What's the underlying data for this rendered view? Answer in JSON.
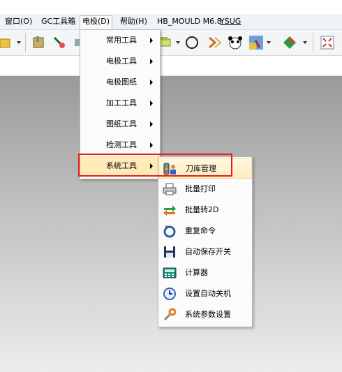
{
  "menubar": {
    "items": [
      "窗口(O)",
      "GC工具箱",
      "电极(D)",
      "帮助(H)",
      "HB_MOULD M6.8",
      "YSUG"
    ]
  },
  "menu_level1": {
    "items": [
      {
        "label": "常用工具"
      },
      {
        "label": "电极工具"
      },
      {
        "label": "电极图纸"
      },
      {
        "label": "加工工具"
      },
      {
        "label": "图纸工具"
      },
      {
        "label": "检测工具"
      },
      {
        "label": "系统工具"
      }
    ]
  },
  "menu_level2": {
    "items": [
      {
        "label": "刀库管理",
        "icon": "tool-library-icon"
      },
      {
        "label": "批量打印",
        "icon": "printer-icon"
      },
      {
        "label": "批量转2D",
        "icon": "convert-arrows-icon"
      },
      {
        "label": "重复命令",
        "icon": "repeat-icon"
      },
      {
        "label": "自动保存开关",
        "icon": "save-floppy-icon"
      },
      {
        "label": "计算器",
        "icon": "calculator-icon"
      },
      {
        "label": "设置自动关机",
        "icon": "clock-icon"
      },
      {
        "label": "系统参数设置",
        "icon": "wrench-icon"
      }
    ]
  },
  "colors": {
    "highlight": "#ffeab8",
    "annotation_box": "#e02020"
  }
}
